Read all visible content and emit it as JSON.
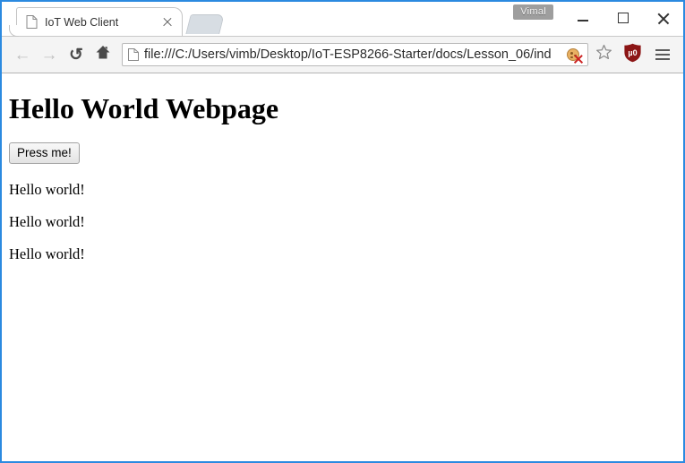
{
  "window": {
    "profile_name": "Vimal",
    "controls": {
      "minimize_label": "Minimize",
      "maximize_label": "Maximize",
      "close_label": "Close"
    }
  },
  "tabstrip": {
    "tabs": [
      {
        "title": "IoT Web Client",
        "favicon": "page-icon",
        "close_label": "×"
      }
    ],
    "new_tab_label": "New tab"
  },
  "toolbar": {
    "back_label": "←",
    "forward_label": "→",
    "reload_label": "⟳",
    "home_label": "Home",
    "omnibox": {
      "url": "file:///C:/Users/vimb/Desktop/IoT-ESP8266-Starter/docs/Lesson_06/ind",
      "favicon": "page-icon",
      "cookie_icon": "cookie-blocked-icon",
      "bookmark_icon": "star-outline-icon"
    },
    "ublock_label": "uO",
    "menu_label": "Menu"
  },
  "page": {
    "heading": "Hello World Webpage",
    "button_label": "Press me!",
    "messages": [
      "Hello world!",
      "Hello world!",
      "Hello world!"
    ]
  },
  "colors": {
    "window_border": "#2b8ae0",
    "toolbar_bg": "#f4f4f4",
    "ublock_red": "#8c1616",
    "cookie_orange": "#e8b063"
  }
}
